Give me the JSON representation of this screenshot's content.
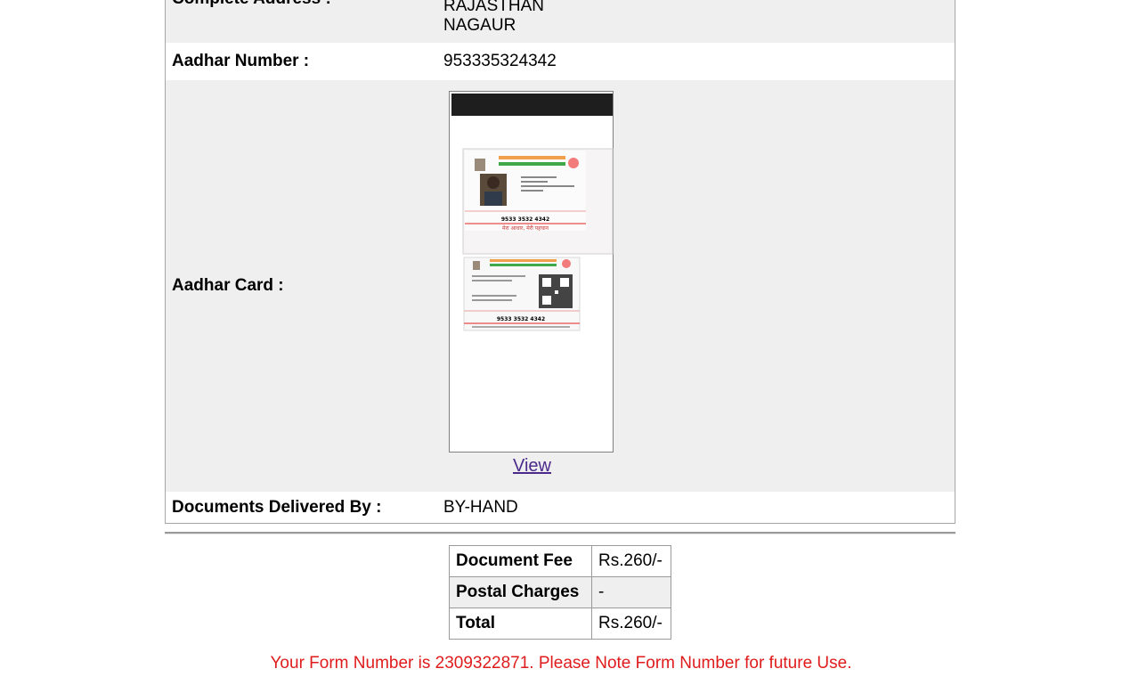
{
  "details": {
    "address_label": "Complete Address :",
    "address_lines": [
      "RAJASTHAN",
      "NAGAUR"
    ],
    "aadhar_number_label": "Aadhar Number :",
    "aadhar_number_value": "953335324342",
    "aadhar_card_label": "Aadhar Card :",
    "view_link": "View",
    "delivered_label": "Documents Delivered By :",
    "delivered_value": "BY-HAND"
  },
  "card_image": {
    "front_number": "9533 3532 4342",
    "front_tagline": "मेरा आधार, मेरी पहचान",
    "back_number": "9533 3532 4342"
  },
  "fees": {
    "rows": [
      {
        "label": "Document Fee",
        "value": "Rs.260/-"
      },
      {
        "label": "Postal Charges",
        "value": "-"
      },
      {
        "label": "Total",
        "value": "Rs.260/-"
      }
    ]
  },
  "notice": "Your Form Number is 2309322871. Please Note Form Number for future Use.",
  "colors": {
    "notice": "#e01b1b",
    "link": "#4b2a8c",
    "shade": "#efefef"
  }
}
